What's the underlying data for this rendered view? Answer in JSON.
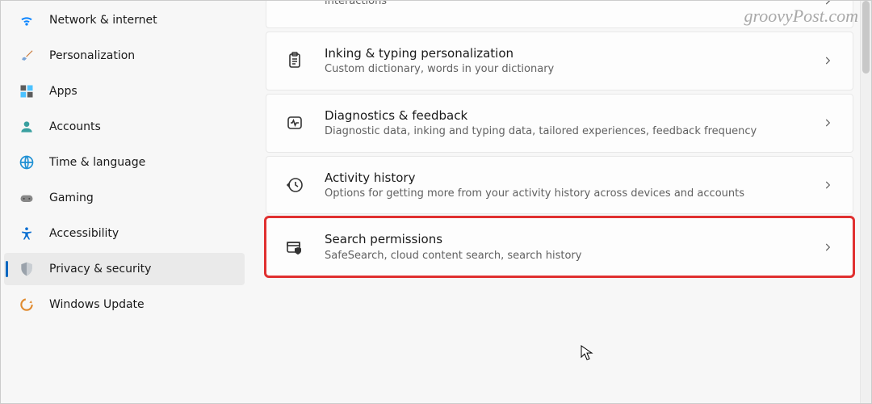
{
  "sidebar": {
    "items": [
      {
        "label": "Network & internet",
        "icon": "wifi-icon",
        "selected": false
      },
      {
        "label": "Personalization",
        "icon": "paintbrush-icon",
        "selected": false
      },
      {
        "label": "Apps",
        "icon": "apps-icon",
        "selected": false
      },
      {
        "label": "Accounts",
        "icon": "person-icon",
        "selected": false
      },
      {
        "label": "Time & language",
        "icon": "globe-clock-icon",
        "selected": false
      },
      {
        "label": "Gaming",
        "icon": "gamepad-icon",
        "selected": false
      },
      {
        "label": "Accessibility",
        "icon": "accessibility-icon",
        "selected": false
      },
      {
        "label": "Privacy & security",
        "icon": "shield-icon",
        "selected": true
      },
      {
        "label": "Windows Update",
        "icon": "update-icon",
        "selected": false
      }
    ]
  },
  "main": {
    "cards": [
      {
        "title": "",
        "desc_trailing": "interactions",
        "icon": "speech-icon",
        "partial": true
      },
      {
        "title": "Inking & typing personalization",
        "desc": "Custom dictionary, words in your dictionary",
        "icon": "clipboard-icon"
      },
      {
        "title": "Diagnostics & feedback",
        "desc": "Diagnostic data, inking and typing data, tailored experiences, feedback frequency",
        "icon": "diagnostics-icon"
      },
      {
        "title": "Activity history",
        "desc": "Options for getting more from your activity history across devices and accounts",
        "icon": "history-icon"
      },
      {
        "title": "Search permissions",
        "desc": "SafeSearch, cloud content search, search history",
        "icon": "search-permissions-icon",
        "highlighted": true
      }
    ]
  },
  "watermark": "groovyPost.com"
}
